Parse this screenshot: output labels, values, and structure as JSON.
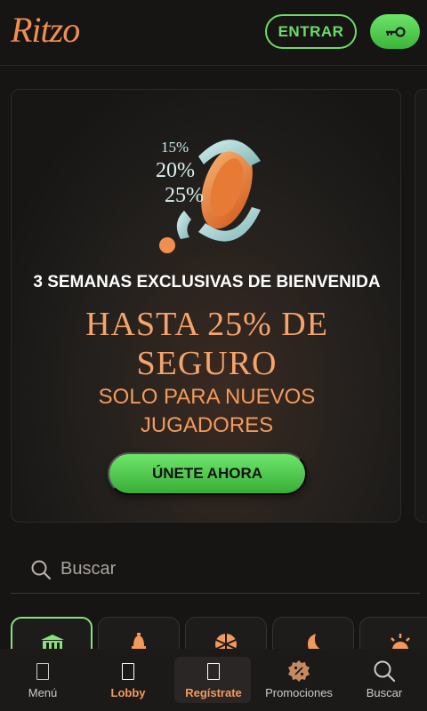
{
  "header": {
    "logo": "Ritzo",
    "login_label": "ENTRAR",
    "register_icon": "key-icon"
  },
  "promo": {
    "art_labels": [
      "15%",
      "20%",
      "25%"
    ],
    "subtitle": "3 SEMANAS EXCLUSIVAS DE BIENVENIDA",
    "title_line1": "HASTA 25% DE",
    "title_line2": "SEGURO",
    "note_line1": "SOLO PARA NUEVOS",
    "note_line2": "JUGADORES",
    "cta_label": "ÚNETE AHORA"
  },
  "search": {
    "placeholder": "Buscar"
  },
  "categories": [
    {
      "icon": "casino-building-icon"
    },
    {
      "icon": "bell-icon"
    },
    {
      "icon": "wheel-icon"
    },
    {
      "icon": "moon-icon"
    },
    {
      "icon": "sunrise-icon"
    }
  ],
  "bottom_nav": [
    {
      "label": "Menú",
      "icon": "menu-icon"
    },
    {
      "label": "Lobby",
      "icon": "lobby-icon"
    },
    {
      "label": "Regístrate",
      "icon": "register-icon"
    },
    {
      "label": "Promociones",
      "icon": "promotions-icon"
    },
    {
      "label": "Buscar",
      "icon": "search-icon"
    }
  ],
  "colors": {
    "accent_orange": "#f39a5b",
    "accent_green": "#6ddb6a",
    "background": "#161514"
  }
}
